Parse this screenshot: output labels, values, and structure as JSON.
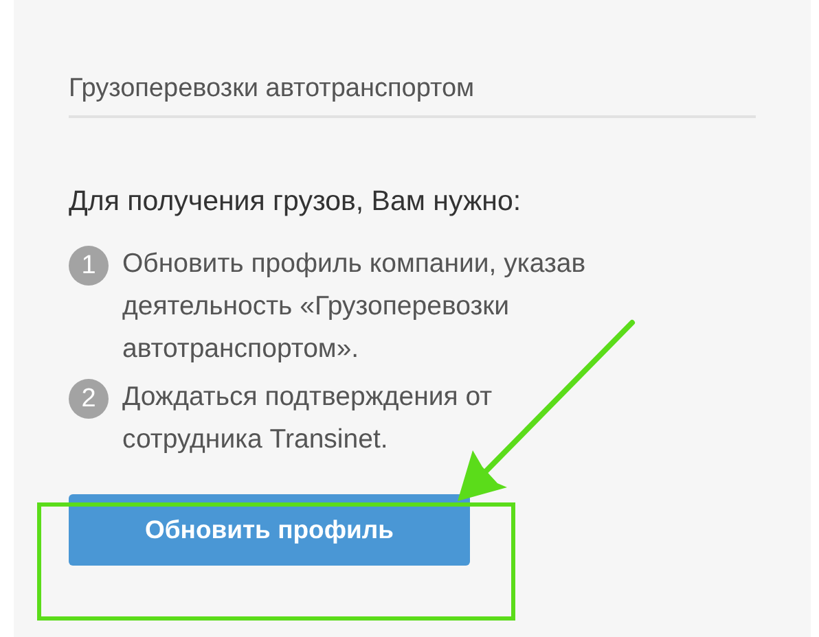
{
  "activity_field": {
    "value": "Грузоперевозки автотранспортом"
  },
  "instructions": {
    "heading": "Для получения грузов, Вам нужно:",
    "steps": [
      {
        "number": "1",
        "text": "Обновить профиль компании, указав деятельность «Грузоперевозки автотранспортом»."
      },
      {
        "number": "2",
        "text": "Дождаться подтверждения от сотрудника Transinet."
      }
    ]
  },
  "buttons": [
    {
      "label": "Обновить профиль"
    }
  ]
}
